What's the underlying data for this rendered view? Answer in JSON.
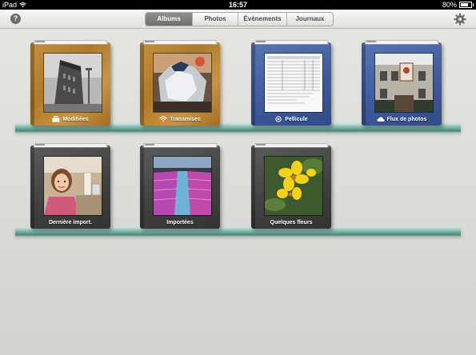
{
  "status": {
    "carrier": "iPad",
    "time": "16:57",
    "battery": "80%",
    "battery_level": 0.8
  },
  "toolbar": {
    "help_glyph": "?",
    "tabs": [
      {
        "label": "Albums",
        "active": true
      },
      {
        "label": "Photos",
        "active": false
      },
      {
        "label": "Événements",
        "active": false
      },
      {
        "label": "Journaux",
        "active": false
      }
    ]
  },
  "albums": [
    {
      "label": "Modifiées",
      "icon": "toolbox-icon",
      "cover": "wood"
    },
    {
      "label": "Transmises",
      "icon": "wifi-icon",
      "cover": "wood"
    },
    {
      "label": "Pellicule",
      "icon": "camera-roll-icon",
      "cover": "blue"
    },
    {
      "label": "Flux de photos",
      "icon": "cloud-icon",
      "cover": "blue"
    },
    {
      "label": "Dernière import.",
      "icon": "",
      "cover": "gray"
    },
    {
      "label": "Importées",
      "icon": "",
      "cover": "gray"
    },
    {
      "label": "Quelques fleurs",
      "icon": "",
      "cover": "gray"
    }
  ],
  "colors": {
    "shelf_glass": "#7fb3a5",
    "wood_cover": "#b07a2a",
    "blue_cover": "#3e5999",
    "gray_cover": "#3f3f3f"
  }
}
